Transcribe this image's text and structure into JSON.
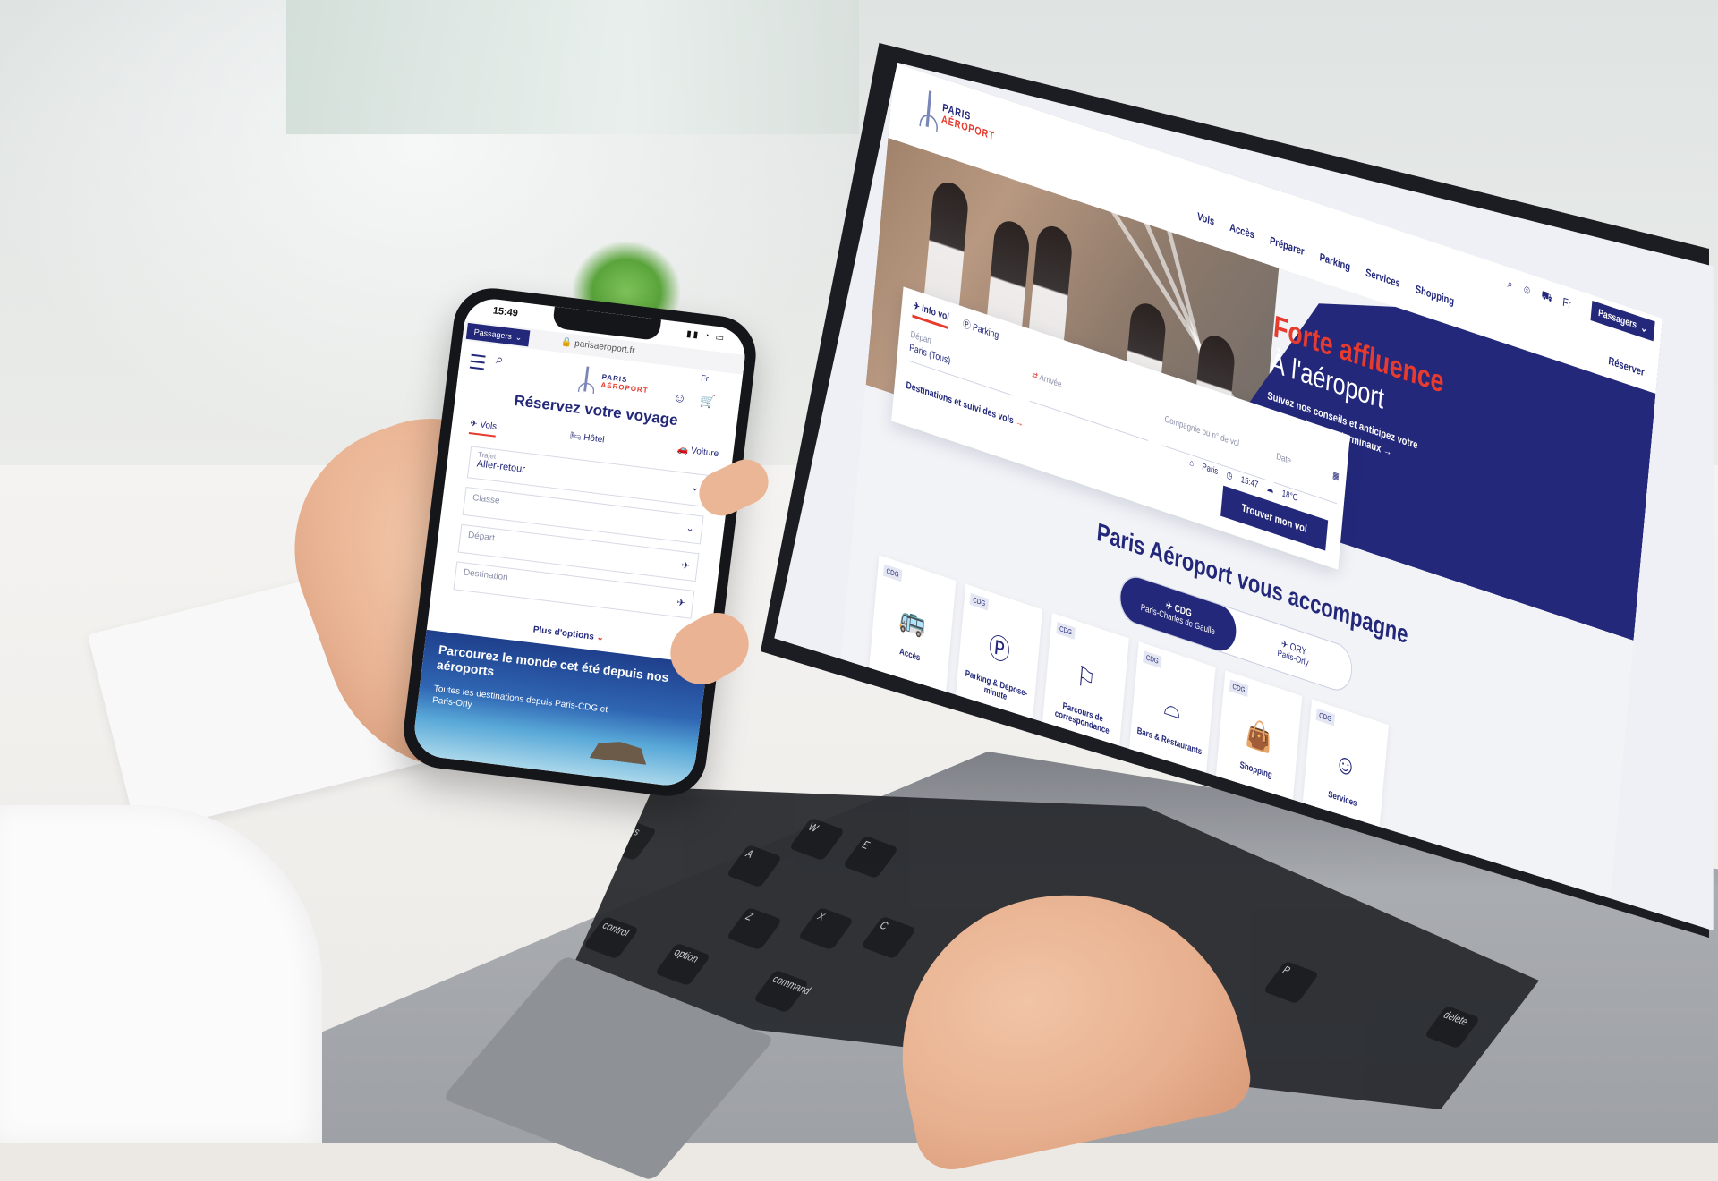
{
  "desktop": {
    "logo": {
      "line1": "PARIS",
      "line2": "AÉROPORT"
    },
    "nav": [
      "Vols",
      "Accès",
      "Préparer",
      "Parking",
      "Services",
      "Shopping"
    ],
    "lang": "Fr",
    "passagers_label": "Passagers",
    "reserver_label": "Réserver",
    "hero": {
      "title": "Forte affluence",
      "subtitle": "À l'aéroport",
      "text": "Suivez nos conseils et anticipez votre passage dans nos terminaux"
    },
    "search": {
      "tabs": [
        "Info vol",
        "Parking"
      ],
      "depart_label": "Départ",
      "depart_value": "Paris (Tous)",
      "arrivee_placeholder": "Arrivée",
      "company_placeholder": "Compagnie ou n° de vol",
      "date_placeholder": "Date",
      "destinations_link": "Destinations et suivi des vols",
      "find_button": "Trouver mon vol",
      "weather": {
        "city": "Paris",
        "time": "15:47",
        "temp": "18°C"
      }
    },
    "accompagne_title": "Paris Aéroport vous accompagne",
    "airports": [
      {
        "code": "CDG",
        "name": "Paris-Charles de Gaulle"
      },
      {
        "code": "ORY",
        "name": "Paris-Orly"
      }
    ],
    "tiles": [
      {
        "badge": "CDG",
        "label": "Accès"
      },
      {
        "badge": "CDG",
        "label": "Parking & Dépose-minute"
      },
      {
        "badge": "CDG",
        "label": "Parcours de correspondance"
      },
      {
        "badge": "CDG",
        "label": "Bars & Restaurants"
      },
      {
        "badge": "CDG",
        "label": "Shopping"
      },
      {
        "badge": "CDG",
        "label": "Services"
      }
    ]
  },
  "keys": [
    "caps lock",
    "A",
    "Z",
    "E",
    "control",
    "option",
    "command",
    "W",
    "X",
    "C",
    "P",
    "delete"
  ],
  "phone": {
    "time": "15:49",
    "url": "parisaeroport.fr",
    "passagers_label": "Passagers",
    "lang": "Fr",
    "logo": {
      "line1": "PARIS",
      "line2": "AÉROPORT"
    },
    "title": "Réservez votre voyage",
    "tabs": [
      "Vols",
      "Hôtel",
      "Voiture"
    ],
    "trajet_label": "Trajet",
    "trajet_value": "Aller-retour",
    "classe_placeholder": "Classe",
    "depart_placeholder": "Départ",
    "destination_placeholder": "Destination",
    "more_options": "Plus d'options",
    "promo": {
      "title": "Parcourez le monde cet été depuis nos aéroports",
      "text": "Toutes les destinations depuis Paris-CDG et Paris-Orly"
    }
  },
  "colors": {
    "brand_blue": "#23287a",
    "accent_red": "#e63b2e"
  }
}
